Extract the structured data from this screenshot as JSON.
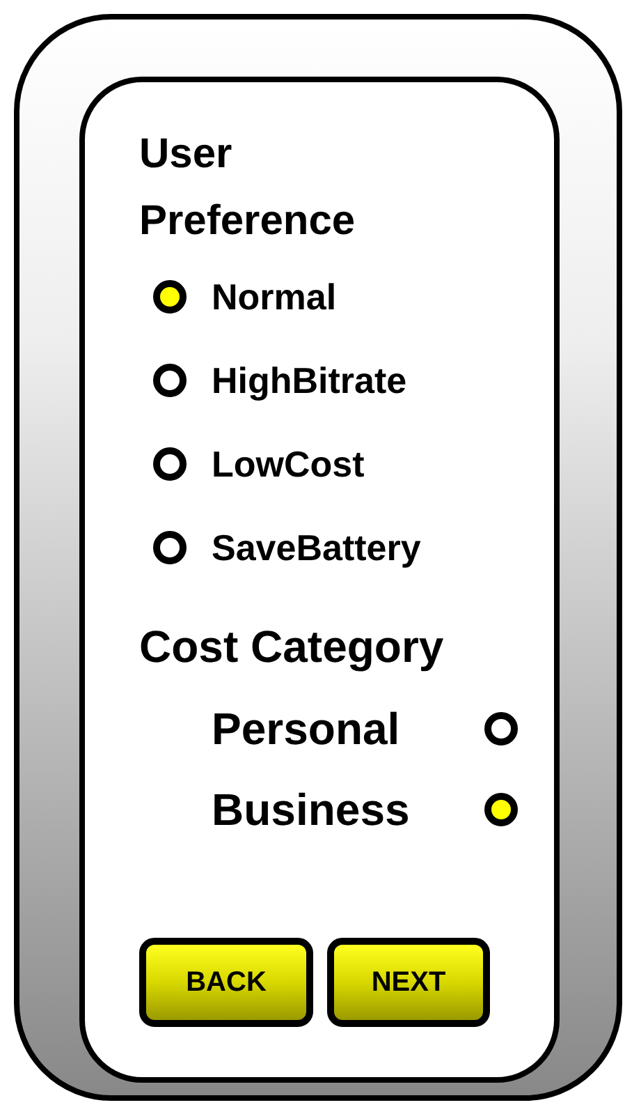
{
  "user_preference": {
    "title": "User Preference",
    "options": [
      {
        "label": "Normal",
        "selected": true
      },
      {
        "label": "HighBitrate",
        "selected": false
      },
      {
        "label": "LowCost",
        "selected": false
      },
      {
        "label": "SaveBattery",
        "selected": false
      }
    ]
  },
  "cost_category": {
    "title": "Cost Category",
    "options": [
      {
        "label": "Personal",
        "selected": false
      },
      {
        "label": "Business",
        "selected": true
      }
    ]
  },
  "buttons": [
    {
      "label": "BACK"
    },
    {
      "label": "NEXT"
    }
  ]
}
